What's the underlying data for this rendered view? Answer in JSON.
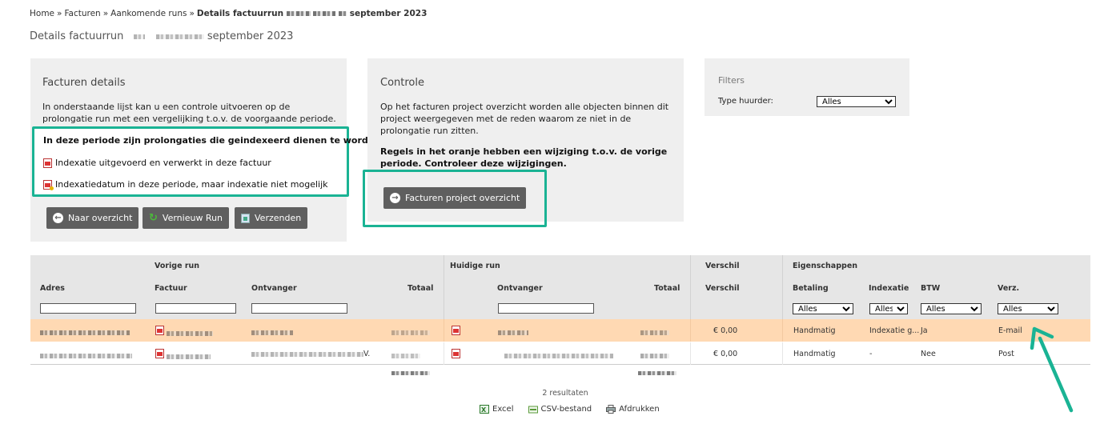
{
  "breadcrumb": {
    "home": "Home",
    "facturen": "Facturen",
    "aankomende": "Aankomende runs",
    "current_prefix": "Details factuurrun",
    "current_suffix": "september 2023",
    "separator": "»"
  },
  "page_title": {
    "prefix": "Details factuurrun",
    "suffix": "september 2023"
  },
  "details_panel": {
    "title": "Facturen details",
    "intro": "In onderstaande lijst kan u een controle uitvoeren op de prolongatie run met een vergelijking t.o.v. de voorgaande periode.",
    "notice": "In deze periode zijn prolongaties die geindexeerd dienen te worden:",
    "legend": [
      {
        "icon": "pdf-indexed-icon",
        "text": "Indexatie uitgevoerd en verwerkt in deze factuur"
      },
      {
        "icon": "pdf-warning-icon",
        "text": "Indexatiedatum in deze periode, maar indexatie niet mogelijk"
      }
    ],
    "buttons": {
      "back": "Naar overzicht",
      "renew": "Vernieuw Run",
      "send": "Verzenden"
    }
  },
  "controle_panel": {
    "title": "Controle",
    "intro": "Op het facturen project overzicht worden alle objecten binnen dit project weergegeven met de reden waarom ze niet in de prolongatie run zitten.",
    "warning": "Regels in het oranje hebben een wijziging t.o.v. de vorige periode. Controleer deze wijzigingen.",
    "button": "Facturen project overzicht"
  },
  "filters_panel": {
    "title": "Filters",
    "type_label": "Type huurder:",
    "type_value": "Alles"
  },
  "table": {
    "groups": {
      "vorige": "Vorige run",
      "huidige": "Huidige run",
      "verschil": "Verschil",
      "eigenschappen": "Eigenschappen"
    },
    "columns": {
      "adres": "Adres",
      "factuur": "Factuur",
      "ontvanger_prev": "Ontvanger",
      "totaal_prev": "Totaal",
      "ontvanger_cur": "Ontvanger",
      "totaal_cur": "Totaal",
      "verschil": "Verschil",
      "betaling": "Betaling",
      "indexatie": "Indexatie",
      "btw": "BTW",
      "verz": "Verz."
    },
    "select_defaults": {
      "betaling": "Alles",
      "indexatie": "Alles",
      "btw": "Alles",
      "verz": "Alles"
    },
    "rows": [
      {
        "verschil": "€ 0,00",
        "betaling": "Handmatig",
        "indexatie": "Indexatie g...",
        "btw": "Ja",
        "verz": "E-mail",
        "ontvanger_prev_suffix": ""
      },
      {
        "verschil": "€ 0,00",
        "betaling": "Handmatig",
        "indexatie": "-",
        "btw": "Nee",
        "verz": "Post",
        "ontvanger_prev_suffix": "V."
      }
    ]
  },
  "results": "2 resultaten",
  "exports": {
    "excel": "Excel",
    "csv": "CSV-bestand",
    "print": "Afdrukken"
  },
  "colors": {
    "accent": "#1ab394",
    "changed_row": "#ffd9b3",
    "button": "#5f5f5f",
    "panel": "#efefef"
  }
}
